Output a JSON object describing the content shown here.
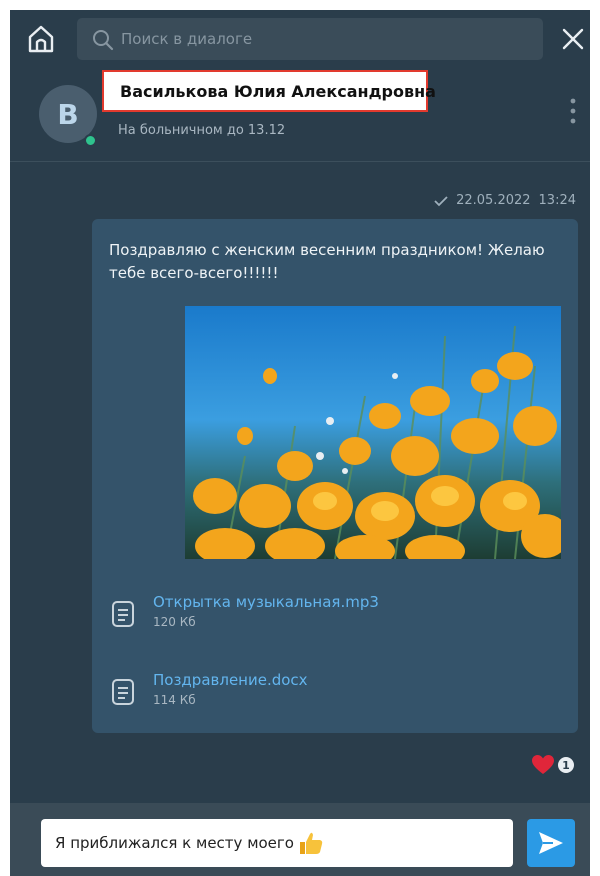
{
  "search": {
    "placeholder": "Поиск в диалоге"
  },
  "contact": {
    "avatar_letter": "В",
    "name": "Василькова Юлия Александровна",
    "status": "На больничном до 13.12"
  },
  "message": {
    "date": "22.05.2022",
    "time": "13:24",
    "text": "Поздравляю с женским весенним праздником! Желаю тебе всего-всего!!!!!!",
    "attachments": [
      {
        "name": "Открытка музыкальная.mp3",
        "size": "120 Кб",
        "icon": "document-icon"
      },
      {
        "name": "Поздравление.docx",
        "size": "114 Кб",
        "icon": "document-icon"
      }
    ],
    "reaction": {
      "emoji": "heart-icon",
      "count": "1"
    }
  },
  "composer": {
    "text": "Я приближался к месту моего"
  },
  "colors": {
    "background": "#2a3d4b",
    "bubble": "#34536a",
    "accent": "#2b9ae5",
    "online": "#2fc38e",
    "highlight": "#e23a2e",
    "link": "#63b5ee"
  }
}
